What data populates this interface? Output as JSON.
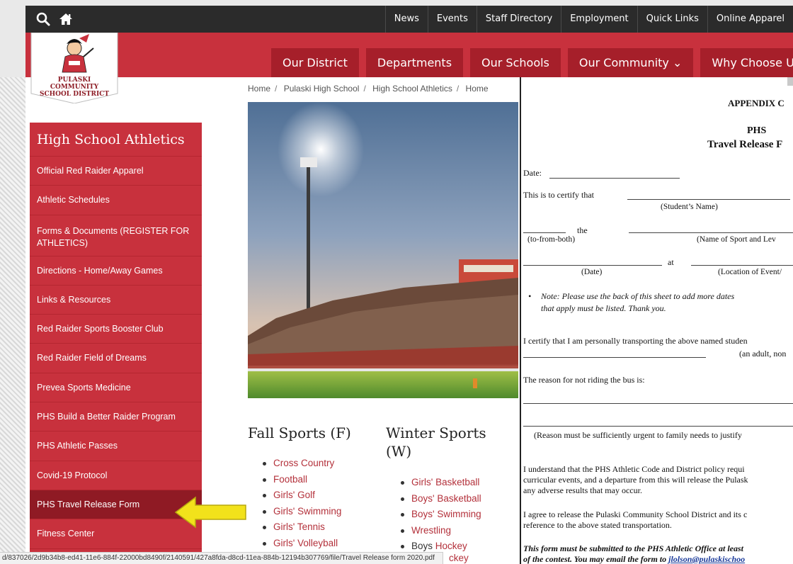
{
  "topbar": {
    "links": [
      "News",
      "Events",
      "Staff Directory",
      "Employment",
      "Quick Links",
      "Online Apparel"
    ]
  },
  "header": {
    "logo_text_line1": "PULASKI COMMUNITY",
    "logo_text_line2": "SCHOOL DISTRICT",
    "nav": [
      "Our District",
      "Departments",
      "Our Schools",
      "Our Community ⌄",
      "Why Choose Us"
    ]
  },
  "breadcrumb": [
    "Home",
    "Pulaski High School",
    "High School Athletics",
    "Home"
  ],
  "sidebar": {
    "title": "High School Athletics",
    "items": [
      "Official Red Raider Apparel",
      "Athletic Schedules",
      "Forms & Documents (REGISTER FOR ATHLETICS)",
      "Directions - Home/Away Games",
      "Links & Resources",
      "Red Raider Sports Booster Club",
      "Red Raider Field of Dreams",
      "Prevea Sports Medicine",
      "PHS Build a Better Raider Program",
      "PHS Athletic Passes",
      "Covid-19 Protocol",
      "PHS Travel Release Form",
      "Fitness Center"
    ],
    "active_item": "PHS Travel Release Form"
  },
  "sports": {
    "fall_heading": "Fall Sports (F)",
    "fall": [
      "Cross Country",
      "Football",
      "Girls' Golf",
      "Girls' Swimming",
      "Girls' Tennis",
      "Girls' Volleyball"
    ],
    "winter_heading_1": "Winter Sports",
    "winter_heading_2": "(W)",
    "winter": [
      "Girls' Basketball",
      "Boys' Basketball",
      "Boys' Swimming",
      "Wrestling"
    ],
    "winter_mixed_prefix": "Boys ",
    "winter_mixed_link": "Hockey",
    "winter_partial": "ckey"
  },
  "statusbar": {
    "url": "d/837026/2d9b34b8-ed41-11e6-884f-22000bd8490f/2140591/427a8fda-d8cd-11ea-884b-12194b307769/file/Travel Release form 2020.pdf"
  },
  "pdf": {
    "appendix": "APPENDIX C",
    "phs": "PHS",
    "title": "Travel Release F",
    "date_label": "Date:",
    "certify_label": "This is to certify that",
    "student_name_caption": "(Student’s Name)",
    "the_label": "the",
    "tofrom_caption": "(to-from-both)",
    "sport_caption": "(Name of Sport and Lev",
    "at_label": "at",
    "date_caption": "(Date)",
    "location_caption": "(Location of Event/",
    "note_line1": "Note:  Please use the back of this sheet to add more dates",
    "note_line2": "that apply must be listed. Thank you.",
    "transport_line1": "I certify that I am personally transporting the above named studen",
    "transport_line2": "(an adult, non",
    "reason_label": "The reason for not riding the bus is:",
    "reason_caption": "(Reason must be sufficiently urgent to family needs to justify",
    "code_line1": "I understand that the PHS Athletic Code and District policy requi",
    "code_line2": "curricular events, and a departure from this will release the Pulask",
    "code_line3": "any adverse results that may occur.",
    "release_line1": "I agree to release the Pulaski Community School District and its c",
    "release_line2": "reference to the above stated transportation.",
    "submit_line1": "This form must be submitted to the PHS Athletic Office at least",
    "submit_line2_prefix": "of the contest.  You may email the form to ",
    "submit_email": "jlolson@pulaskischoo"
  },
  "colors": {
    "brand_red": "#c8313d",
    "dark_red": "#a61f2a",
    "topbar": "#2b2b2b",
    "arrow_yellow": "#f2e21b"
  }
}
